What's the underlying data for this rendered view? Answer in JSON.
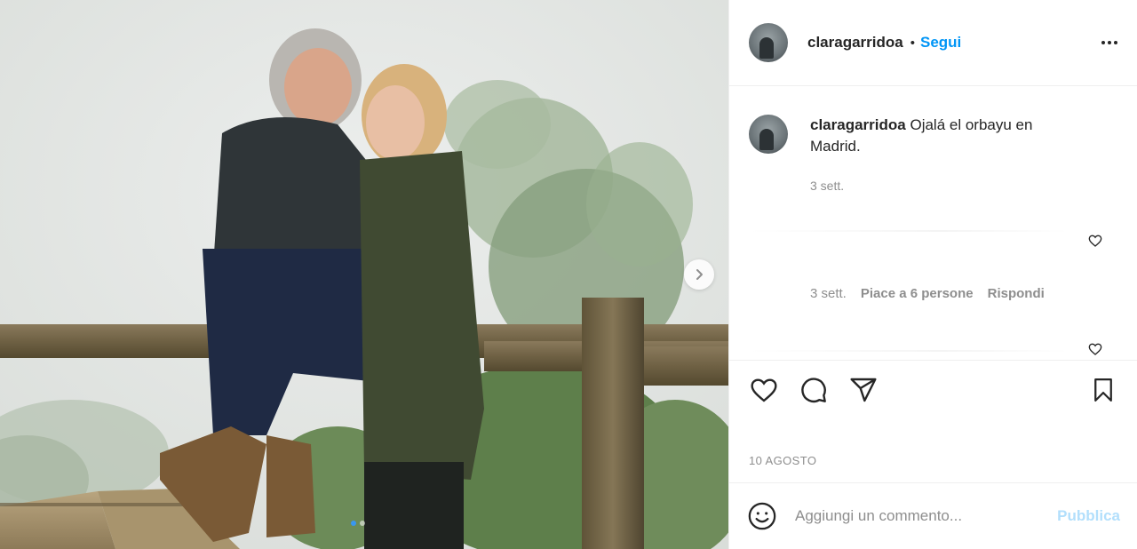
{
  "post": {
    "username": "claragarridoa",
    "follow_separator": "•",
    "follow_label": "Segui",
    "caption": {
      "username": "claragarridoa",
      "text": "Ojalá el orbayu en Madrid.",
      "time": "3 sett."
    },
    "comment_meta": {
      "time": "3 sett.",
      "likes": "Piace a 6 persone",
      "reply": "Rispondi"
    },
    "date": "10 AGOSTO",
    "add_comment": {
      "placeholder": "Aggiungi un commento...",
      "publish_label": "Pubblica"
    },
    "carousel": {
      "current_index": 1,
      "total": 2
    }
  },
  "icons": {
    "more": "more-horizontal-icon",
    "like": "heart-icon",
    "comment": "comment-icon",
    "share": "paper-plane-icon",
    "save": "bookmark-icon",
    "emoji": "smiley-icon",
    "next": "chevron-right-icon"
  },
  "colors": {
    "link_blue": "#0095f6",
    "publish_disabled": "#b2dffc",
    "secondary_text": "#8e8e8e",
    "primary_text": "#262626",
    "divider": "#efefef"
  }
}
